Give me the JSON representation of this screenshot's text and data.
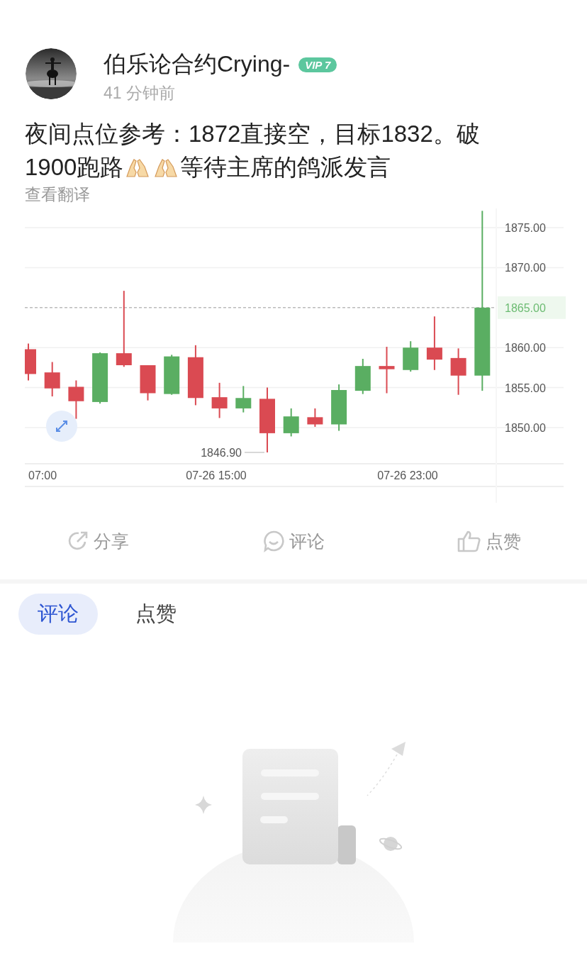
{
  "author": {
    "name": "伯乐论合约Crying-",
    "badge": "VIP 7",
    "time": "41 分钟前"
  },
  "post": {
    "lines": [
      [
        {
          "kind": "text",
          "text": "夜间点位参考：1872直接空，目标1832。破"
        }
      ],
      [
        {
          "kind": "text",
          "text": "1900跑路"
        },
        {
          "kind": "emoji"
        },
        {
          "kind": "emoji"
        },
        {
          "kind": "text",
          "text": "等待主席的鸽派发言"
        }
      ]
    ],
    "translate_link": "查看翻译"
  },
  "chart": {
    "price_labels": [
      {
        "text": "1875.00",
        "highlighted": false
      },
      {
        "text": "1870.00",
        "highlighted": false
      },
      {
        "text": "1865.00",
        "highlighted": true
      },
      {
        "text": "1860.00",
        "highlighted": false
      },
      {
        "text": "1855.00",
        "highlighted": false
      },
      {
        "text": "1850.00",
        "highlighted": false
      }
    ],
    "time_labels": [
      "07:00",
      "07-26 15:00",
      "07-26 23:00"
    ],
    "low_label": "1846.90"
  },
  "actions": [
    {
      "kind": "share",
      "label": "分享"
    },
    {
      "kind": "comment",
      "label": "评论"
    },
    {
      "kind": "like",
      "label": "点赞"
    }
  ],
  "tabs": [
    {
      "label": "评论",
      "selected": true
    },
    {
      "label": "点赞",
      "selected": false
    }
  ]
}
